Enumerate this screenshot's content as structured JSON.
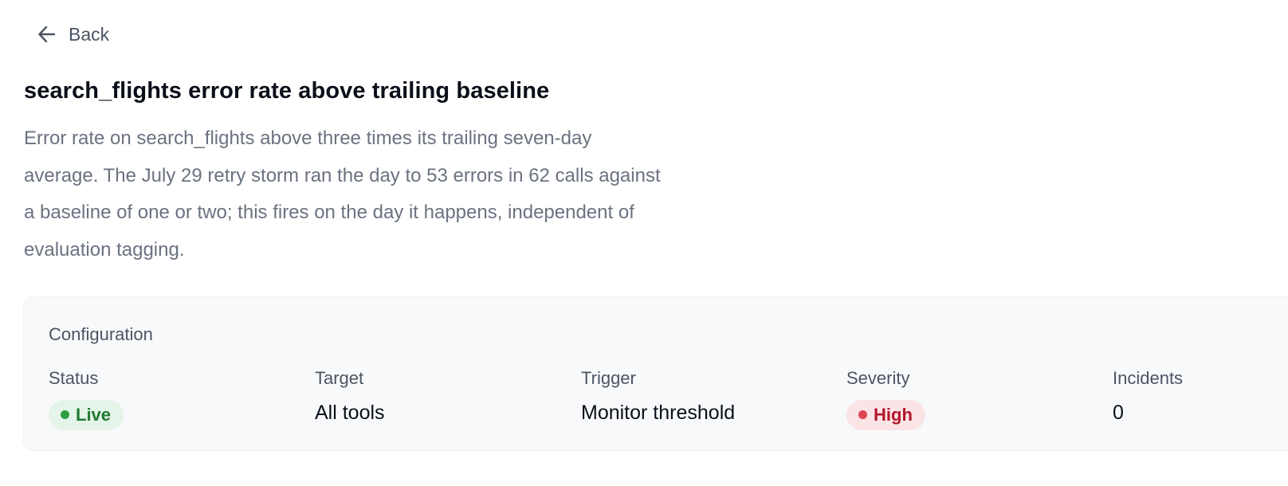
{
  "back": {
    "label": "Back",
    "icon": "arrow-left-icon"
  },
  "alert": {
    "title": "search_flights error rate above trailing baseline",
    "description": "Error rate on search_flights above three times its trailing seven-day average. The July 29 retry storm ran the day to 53 errors in 62 calls against a baseline of one or two; this fires on the day it happens, independent of evaluation tagging."
  },
  "configuration": {
    "heading": "Configuration",
    "fields": [
      {
        "label": "Status",
        "value": "Live",
        "kind": "badge",
        "color": "#2f9e44"
      },
      {
        "label": "Target",
        "value": "All tools",
        "kind": "text"
      },
      {
        "label": "Trigger",
        "value": "Monitor threshold",
        "kind": "text"
      },
      {
        "label": "Severity",
        "value": "High",
        "kind": "badge",
        "color": "#e04555"
      },
      {
        "label": "Incidents",
        "value": "0",
        "kind": "text"
      }
    ]
  }
}
